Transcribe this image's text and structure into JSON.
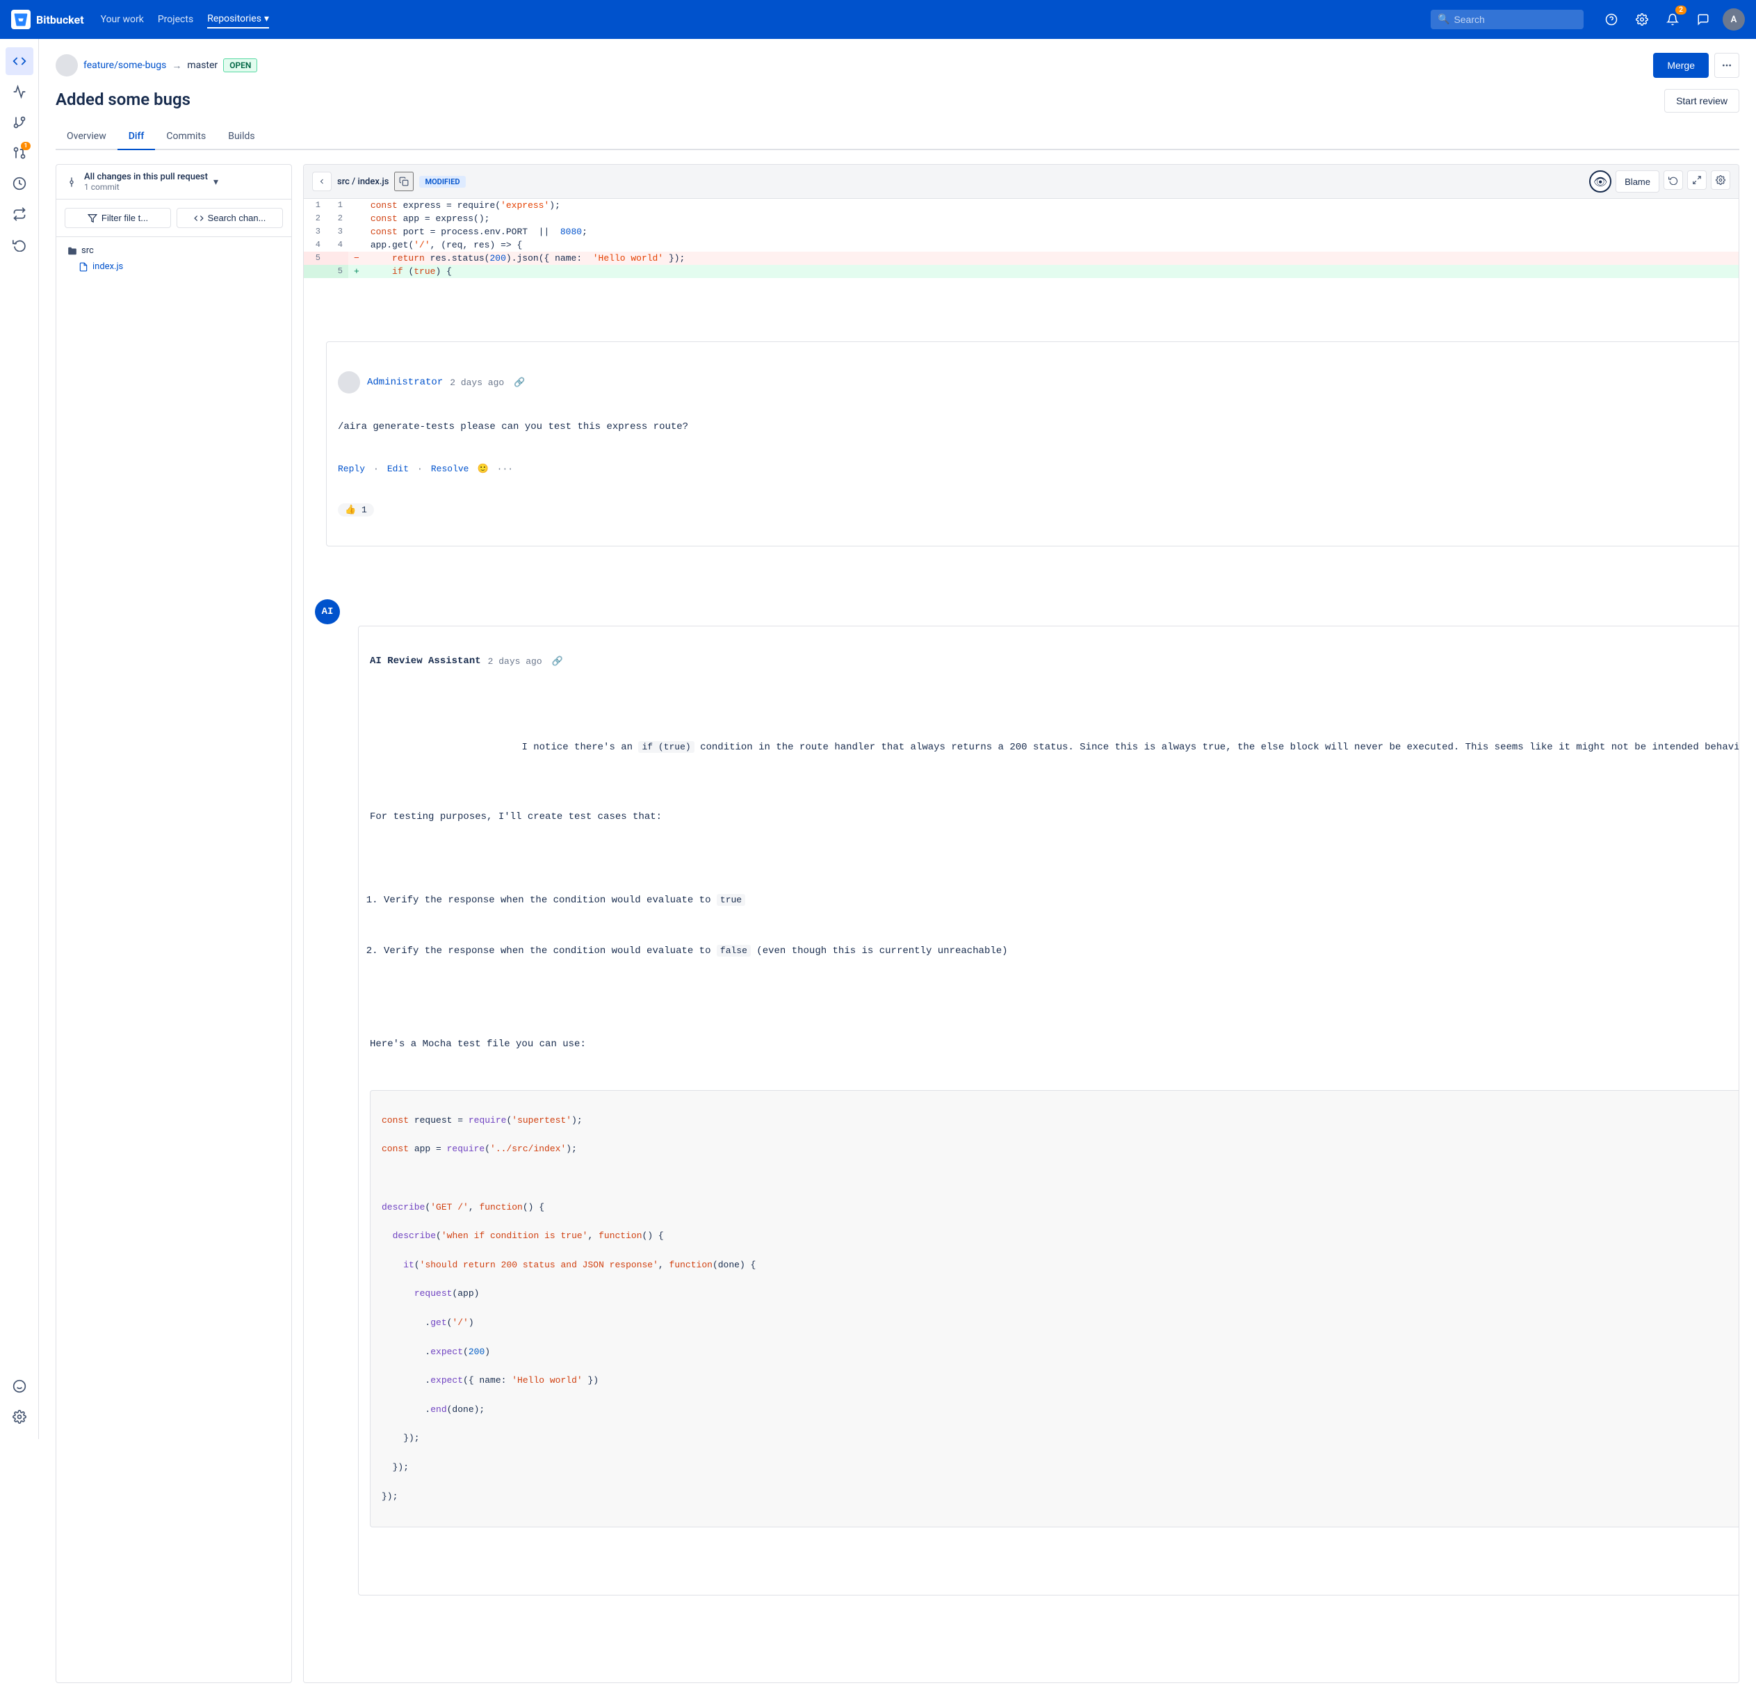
{
  "app": {
    "name": "Bitbucket",
    "logo_text": "Bitbucket"
  },
  "nav": {
    "links": [
      {
        "id": "your-work",
        "label": "Your work"
      },
      {
        "id": "projects",
        "label": "Projects"
      },
      {
        "id": "repositories",
        "label": "Repositories",
        "active": true,
        "has_dropdown": true
      }
    ],
    "search_placeholder": "Search",
    "notifications_count": "2"
  },
  "pr": {
    "from_branch": "feature/some-bugs",
    "to_branch": "master",
    "status": "OPEN",
    "title": "Added some bugs",
    "merge_label": "Merge",
    "start_review_label": "Start review"
  },
  "tabs": [
    {
      "id": "overview",
      "label": "Overview"
    },
    {
      "id": "diff",
      "label": "Diff",
      "active": true
    },
    {
      "id": "commits",
      "label": "Commits"
    },
    {
      "id": "builds",
      "label": "Builds"
    }
  ],
  "diff_sidebar": {
    "dropdown_label": "All changes in this pull request",
    "dropdown_sub": "1 commit",
    "filter_file_label": "Filter file t...",
    "search_changes_label": "Search chan...",
    "folder": "src",
    "file": "index.js"
  },
  "diff_viewer": {
    "file_path_prefix": "src / ",
    "file_name": "index.js",
    "modified_label": "MODIFIED",
    "blame_label": "Blame",
    "lines": [
      {
        "old": "1",
        "new": "1",
        "type": "normal",
        "content": "const express = require('express');"
      },
      {
        "old": "2",
        "new": "2",
        "type": "normal",
        "content": "const app = express();"
      },
      {
        "old": "3",
        "new": "3",
        "type": "normal",
        "content": "const port = process.env.PORT  ||  8080;"
      },
      {
        "old": "4",
        "new": "4",
        "type": "normal",
        "content": "app.get('/', (req, res) => {"
      },
      {
        "old": "5",
        "new": "",
        "type": "deleted",
        "content": "    return res.status(200).json({ name:  'Hello world' });"
      },
      {
        "old": "",
        "new": "5",
        "type": "added",
        "content": "    if (true) {"
      }
    ]
  },
  "comment": {
    "author": "Administrator",
    "time": "2 days ago",
    "body": "/aira generate-tests please can you test this express route?",
    "reply_label": "Reply",
    "edit_label": "Edit",
    "resolve_label": "Resolve",
    "reactions": "👍 1"
  },
  "ai_comment": {
    "author": "AI Review Assistant",
    "time": "2 days ago",
    "intro": "I notice there's an ",
    "code1": "if (true)",
    "mid1": " condition in the route handler that always returns a 200 status. Since this is always true, the else block will never be executed. This seems like it might not be intended behavior.",
    "test_intro": "For testing purposes, I'll create test cases that:",
    "list_items": [
      {
        "num": "1.",
        "text_pre": "Verify the response when the condition would evaluate to ",
        "code": "true",
        "text_post": ""
      },
      {
        "num": "2.",
        "text_pre": "Verify the response when the condition would evaluate to ",
        "code": "false",
        "text_post": " (even though this is currently unreachable)"
      }
    ],
    "mocha_label": "Here's a Mocha test file you can use:",
    "code_lines": [
      "const request = require('supertest');",
      "const app = require('../src/index');",
      "",
      "describe('GET /', function() {",
      "  describe('when if condition is true', function() {",
      "    it('should return 200 status and JSON response', function(done) {",
      "      request(app)",
      "        .get('/')",
      "        .expect(200)",
      "        .expect({ name: 'Hello world' })",
      "        .end(done);",
      "    });",
      "  });",
      "});"
    ]
  },
  "sidebar_icons": [
    {
      "id": "code",
      "icon": "code",
      "active": true
    },
    {
      "id": "activity",
      "icon": "activity"
    },
    {
      "id": "branch",
      "icon": "branch"
    },
    {
      "id": "pull-request",
      "icon": "pr",
      "badge": "1"
    },
    {
      "id": "pipeline",
      "icon": "pipeline"
    },
    {
      "id": "refresh",
      "icon": "refresh"
    },
    {
      "id": "deploy",
      "icon": "deploy"
    },
    {
      "id": "face",
      "icon": "face"
    },
    {
      "id": "settings",
      "icon": "settings"
    }
  ]
}
